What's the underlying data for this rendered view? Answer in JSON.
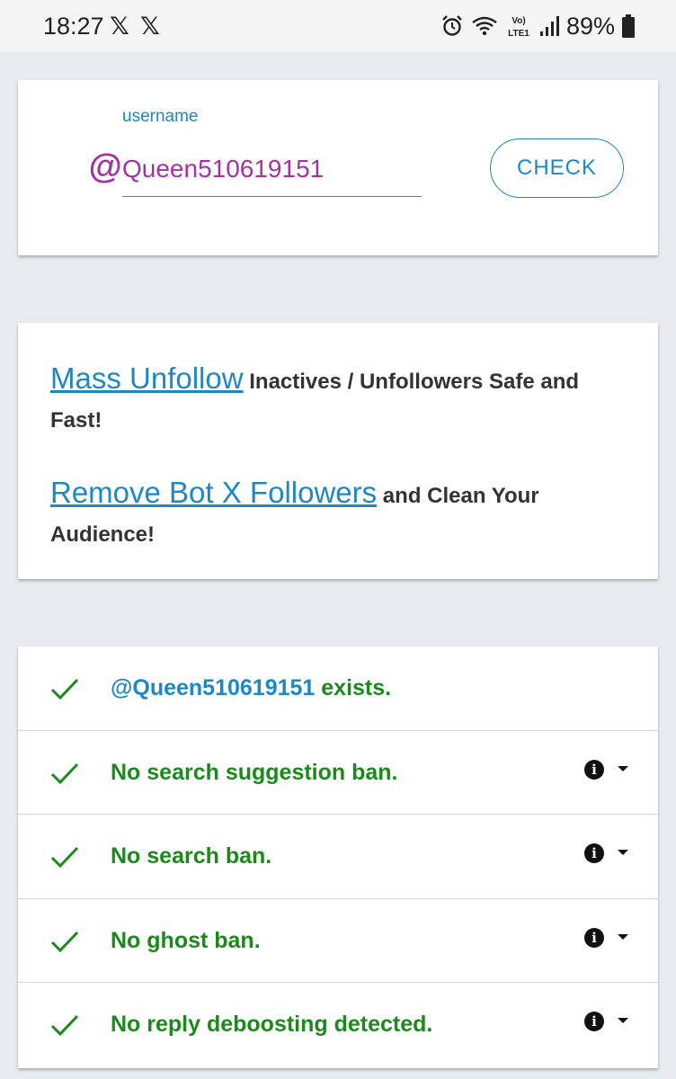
{
  "status_bar": {
    "time": "18:27",
    "x_logo": "𝕏",
    "battery": "89%"
  },
  "check_form": {
    "at_symbol": "@",
    "label": "username",
    "username": "Queen510619151",
    "button_label": "CHECK"
  },
  "promo": {
    "line1_link": "Mass Unfollow",
    "line1_text": " Inactives / Unfollowers Safe and Fast!",
    "line2_link": "Remove Bot X Followers",
    "line2_text": " and Clean Your Audience!"
  },
  "results": {
    "exists_handle": "@Queen510619151",
    "exists_text": " exists.",
    "items": [
      {
        "label": "No search suggestion ban."
      },
      {
        "label": "No search ban."
      },
      {
        "label": "No ghost ban."
      },
      {
        "label": "No reply deboosting detected."
      }
    ],
    "info_glyph": "i"
  },
  "colors": {
    "accent_blue": "#1e88c3",
    "username_purple": "#a333a5",
    "success_green": "#1a8a1a",
    "background": "#e7ebef"
  },
  "icons": {
    "status": [
      "x-logo-icon",
      "alarm-icon",
      "wifi-icon",
      "volte-icon",
      "signal-icon",
      "battery-icon"
    ],
    "results": [
      "check-icon",
      "info-icon",
      "caret-down-icon"
    ]
  }
}
